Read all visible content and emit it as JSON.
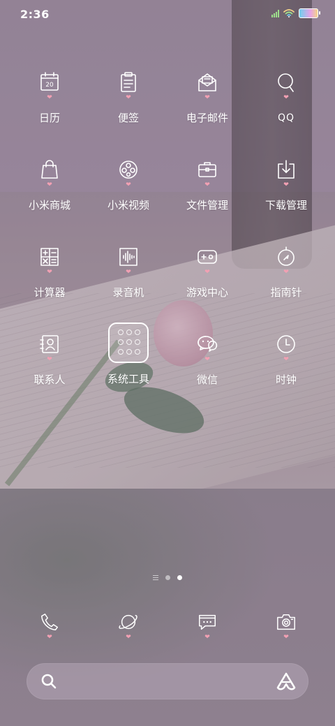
{
  "status_bar": {
    "time": "2:36",
    "signal_color": "#9ee08c"
  },
  "apps": [
    {
      "label": "日历",
      "icon": "calendar-icon",
      "icon_text": "20"
    },
    {
      "label": "便签",
      "icon": "notes-icon"
    },
    {
      "label": "电子邮件",
      "icon": "email-icon"
    },
    {
      "label": "QQ",
      "icon": "qq-icon"
    },
    {
      "label": "小米商城",
      "icon": "shopping-bag-icon"
    },
    {
      "label": "小米视频",
      "icon": "film-reel-icon"
    },
    {
      "label": "文件管理",
      "icon": "briefcase-icon"
    },
    {
      "label": "下载管理",
      "icon": "download-icon"
    },
    {
      "label": "计算器",
      "icon": "calculator-icon"
    },
    {
      "label": "录音机",
      "icon": "sound-wave-icon"
    },
    {
      "label": "游戏中心",
      "icon": "gamepad-icon"
    },
    {
      "label": "指南针",
      "icon": "compass-icon"
    },
    {
      "label": "联系人",
      "icon": "contact-card-icon"
    },
    {
      "label": "系统工具",
      "icon": "folder-icon"
    },
    {
      "label": "微信",
      "icon": "wechat-icon"
    },
    {
      "label": "时钟",
      "icon": "clock-icon"
    }
  ],
  "pager": {
    "pages": 2,
    "active_page": 2
  },
  "dock": [
    {
      "name": "phone",
      "icon": "phone-icon"
    },
    {
      "name": "browser",
      "icon": "planet-icon"
    },
    {
      "name": "messages",
      "icon": "message-bubble-icon"
    },
    {
      "name": "camera",
      "icon": "camera-icon"
    }
  ],
  "search_bar": {
    "left_icon": "search-icon",
    "right_icon": "assistant-icon"
  },
  "colors": {
    "heart": "#f2a0b3",
    "icon_stroke": "#ffffff",
    "search_bar_bg": "rgba(180,165,182,.55)"
  }
}
